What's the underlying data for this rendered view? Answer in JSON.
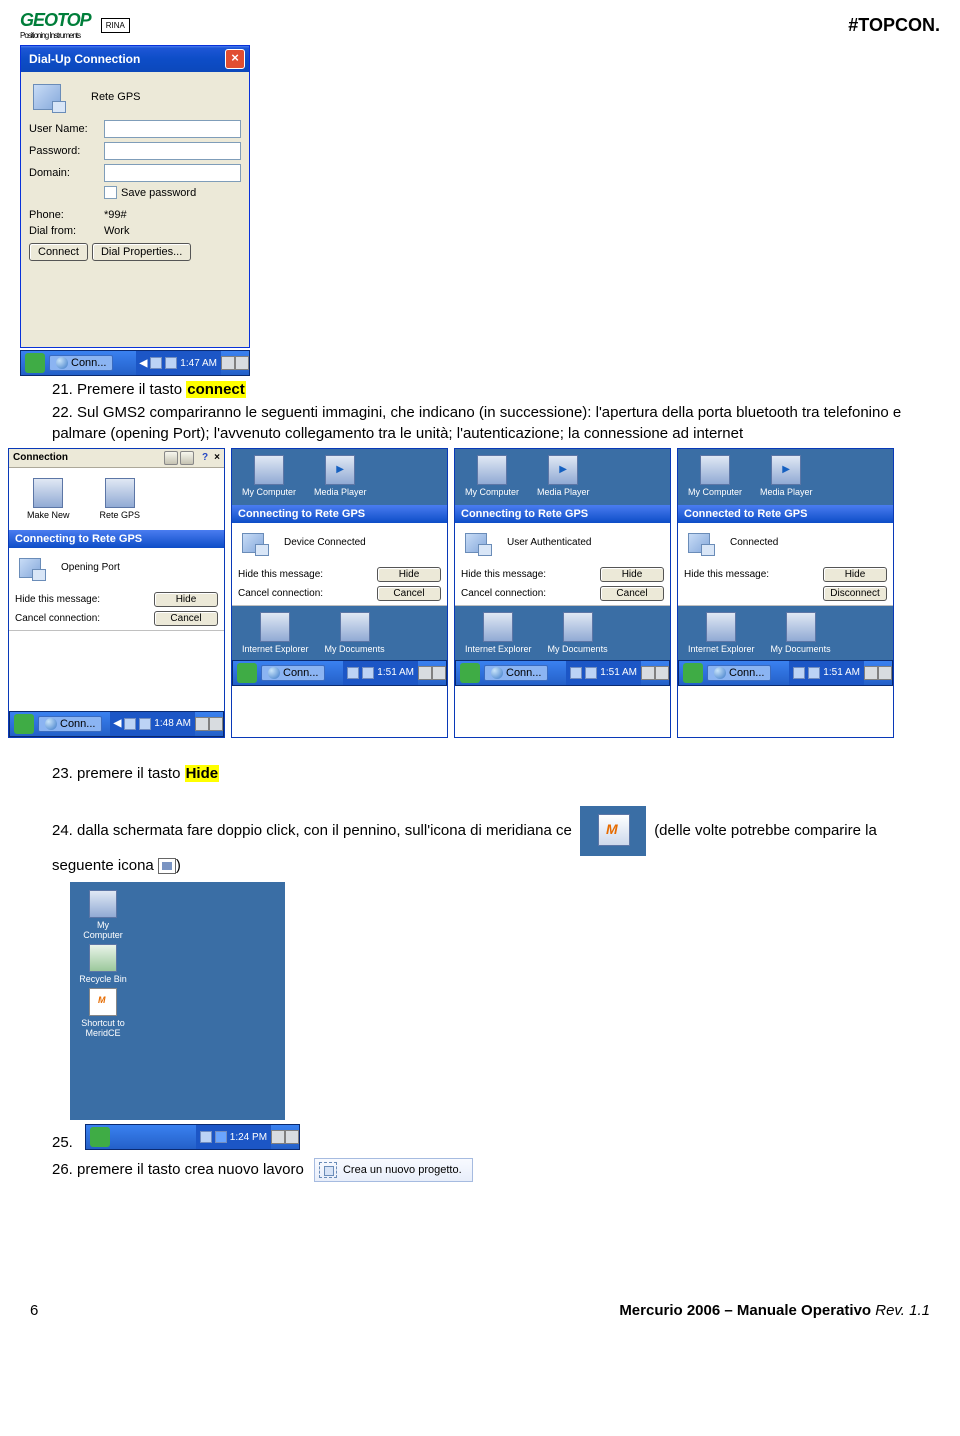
{
  "header": {
    "logo_left": "GEOTOP",
    "logo_left_sub": "Positioning Instruments",
    "logo_cert": "RINA",
    "logo_right": "TOPCON"
  },
  "dialog": {
    "title": "Dial-Up Connection",
    "conn_name": "Rete GPS",
    "fields": {
      "username": "User Name:",
      "password": "Password:",
      "domain": "Domain:",
      "save_pw": "Save password",
      "phone": "Phone:",
      "phone_val": "*99#",
      "dial_from": "Dial from:",
      "dial_from_val": "Work"
    },
    "buttons": {
      "connect": "Connect",
      "dial_props": "Dial Properties..."
    }
  },
  "taskbar1": {
    "task_label": "Conn...",
    "time": "1:47 AM"
  },
  "steps": {
    "s21_num": "21.",
    "s21": "Premere il tasto ",
    "s21_hl": "connect",
    "s22_num": "22.",
    "s22": "Sul GMS2 compariranno le seguenti immagini, che indicano (in successione): l'apertura della porta bluetooth tra telefonino e palmare (opening Port); l'avvenuto collegamento tra le unità; l'autenticazione; la connessione ad internet",
    "s23_num": "23.",
    "s23": "premere il tasto ",
    "s23_hl": "Hide",
    "s24_num": "24.",
    "s24a": "dalla schermata fare doppio click, con il pennino, sull'icona di meridiana ce ",
    "s24b": " (delle volte potrebbe comparire la seguente icona ",
    "s24c": ")",
    "s25_num": "25.",
    "s26_num": "26.",
    "s26": "premere il tasto crea nuovo lavoro",
    "s26_btn": "Crea un nuovo progetto."
  },
  "shots": {
    "panel1": {
      "top_title": "Connection",
      "ico1": "Make New",
      "ico2": "Rete GPS",
      "banner": "Connecting to Rete GPS",
      "status": "Opening Port",
      "hide_msg": "Hide this message:",
      "cancel_msg": "Cancel connection:",
      "btn_hide": "Hide",
      "btn_cancel": "Cancel",
      "time": "1:48 AM",
      "task": "Conn..."
    },
    "panel2": {
      "ico1": "My Computer",
      "ico2": "Media Player",
      "banner": "Connecting to Rete GPS",
      "status": "Device Connected",
      "hide_msg": "Hide this message:",
      "cancel_msg": "Cancel connection:",
      "btn_hide": "Hide",
      "btn_cancel": "Cancel",
      "b_ico1": "Internet Explorer",
      "b_ico2": "My Documents",
      "time": "1:51 AM",
      "task": "Conn..."
    },
    "panel3": {
      "ico1": "My Computer",
      "ico2": "Media Player",
      "banner": "Connecting to Rete GPS",
      "status": "User Authenticated",
      "hide_msg": "Hide this message:",
      "cancel_msg": "Cancel connection:",
      "btn_hide": "Hide",
      "btn_cancel": "Cancel",
      "b_ico1": "Internet Explorer",
      "b_ico2": "My Documents",
      "time": "1:51 AM",
      "task": "Conn..."
    },
    "panel4": {
      "ico1": "My Computer",
      "ico2": "Media Player",
      "banner": "Connected to Rete GPS",
      "status": "Connected",
      "hide_msg": "Hide this message:",
      "cancel_msg": "",
      "btn_hide": "Hide",
      "btn_cancel": "Disconnect",
      "b_ico1": "Internet Explorer",
      "b_ico2": "My Documents",
      "time": "1:51 AM",
      "task": "Conn..."
    }
  },
  "desk2": {
    "i1": "My Computer",
    "i2": "Recycle Bin",
    "i3": "Shortcut to MeridCE",
    "time": "1:24 PM"
  },
  "footer": {
    "page": "6",
    "title": "Mercurio 2006 – Manuale Operativo ",
    "rev": "Rev. 1.1"
  }
}
